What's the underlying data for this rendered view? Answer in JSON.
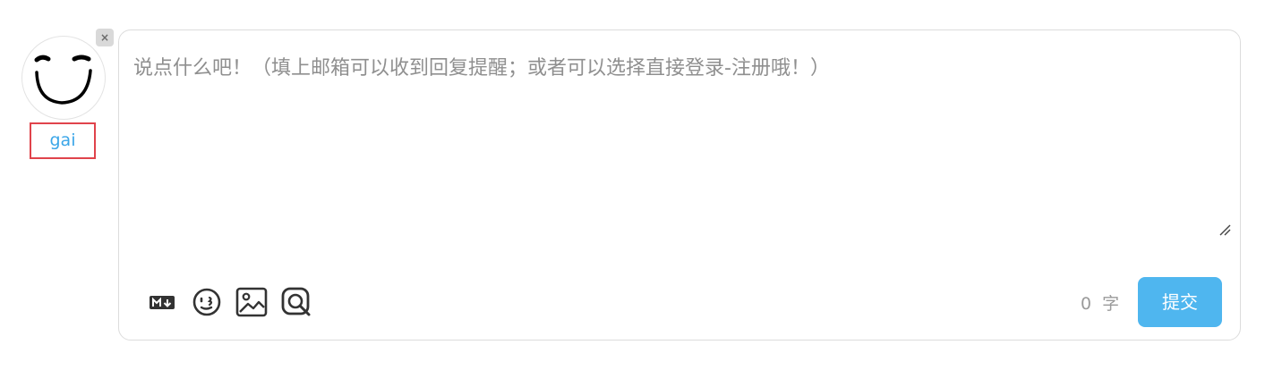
{
  "user": {
    "name": "gai"
  },
  "comment": {
    "placeholder": "说点什么吧！（填上邮箱可以收到回复提醒；或者可以选择直接登录-注册哦！）",
    "char_count": "0",
    "char_unit": "字",
    "submit_label": "提交"
  },
  "toolbar": {
    "icons": [
      "markdown-icon",
      "emoji-icon",
      "image-icon",
      "preview-icon"
    ]
  },
  "close_label": "×",
  "colors": {
    "accent": "#4fb6ef",
    "username": "#3ba6e8",
    "highlight_border": "#e0434b"
  }
}
